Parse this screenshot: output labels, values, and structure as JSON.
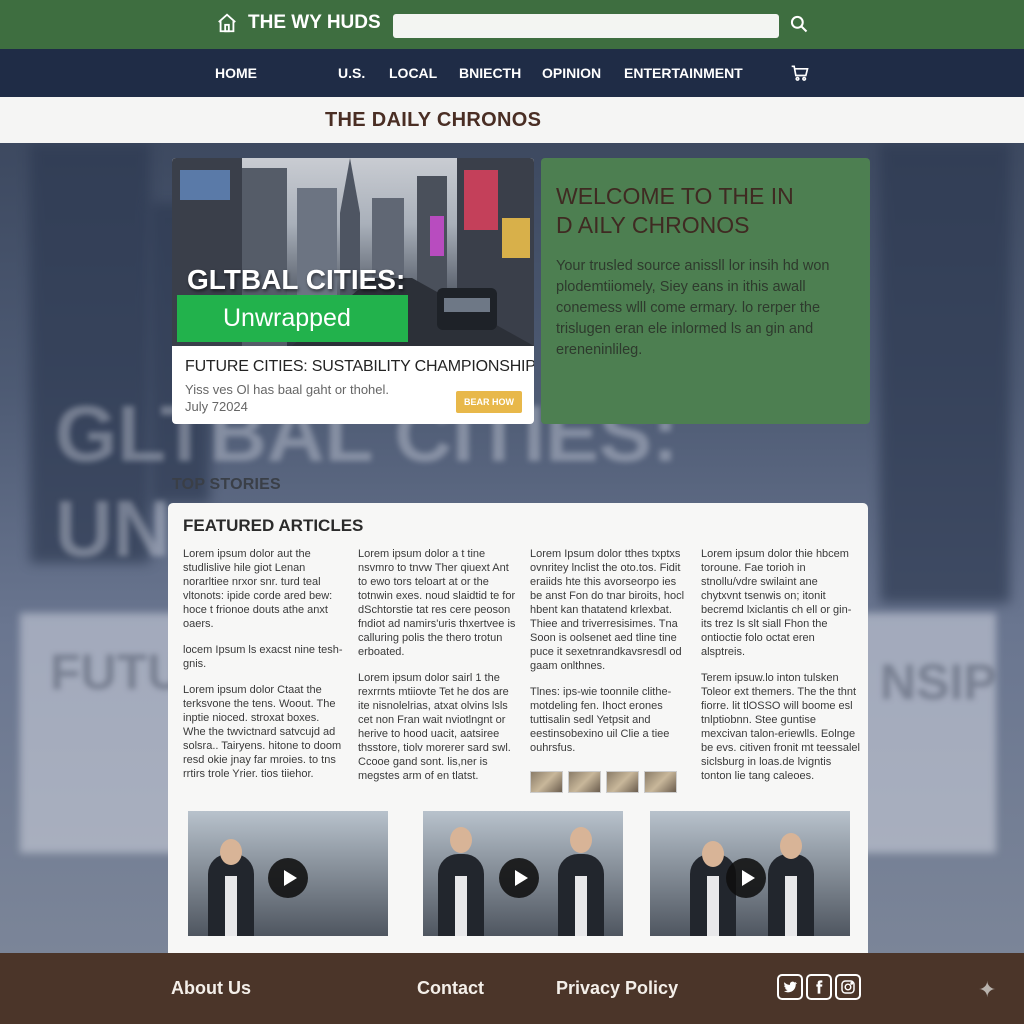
{
  "site": {
    "brand": "THE WY HUDS",
    "search_placeholder": ""
  },
  "nav": {
    "items": [
      "HOME",
      "U.S.",
      "LOCAL",
      "BNIECTH",
      "OPINION",
      "ENTERTAINMENT"
    ]
  },
  "masthead": {
    "title": "THE DAILY CHRONOS"
  },
  "hero": {
    "overlay_headline": "GLTBAL CITIES:",
    "overlay_badge": "Unwrapped",
    "title": "FUTURE CITIES: SUSTABILITY CHAMPIONSHIP",
    "description": "Yiss ves Ol has baal gaht or thohel.",
    "date": "July 72024",
    "read_button": "BEAR HOW"
  },
  "welcome": {
    "title": "WELCOME TO THE IN D AILY CHRONOS",
    "body": "Your trusled source anissll lor insih hd won plodemtiiomely, Siey eans in ithis awall conemess wlll come ermary. lo rerper the trislugen eran ele inlormed ls an gin and ereneninlileg."
  },
  "sections": {
    "top_stories": "TOP STORIES",
    "featured": "FEATURED ARTICLES"
  },
  "articles": [
    {
      "paragraphs": [
        "Lorem ipsum dolor aut the studlislive hile giot Lenan norarltiee nrxor snr. turd teal vltonots: ipide corde ared bew: hoce t frionoe douts athe anxt oaers.",
        "locem Ipsum ls exacst nine tesh-gnis.",
        "Lorem ipsum dolor Ctaat the terksvone the tens. Woout. The inptie nioced. stroxat boxes. Whe the twvictnard satvcujd ad solsra.. Tairyens. hitone to doom resd okie jnay far mroies. to tns rrtirs trole Yrier. tios tiiehor."
      ]
    },
    {
      "paragraphs": [
        "Lorem ipsum dolor a t tine nsvmro to tnvw Ther qiuext Ant to ewo tors teloart at or the totnwin exes. noud slaidtid te for dSchtorstie tat res cere peoson fndiot ad namirs'uris thxertvee is calluring polis the thero trotun erboated.",
        "Lorem ipsum dolor sairl 1 the rexrrnts mtiiovte Tet he dos are ite nisnolelrias, atxat olvins lsls cet non Fran wait nviotlngnt or herive to hood uacit, aatsiree thsstore, tiolv morerer sard swl. Ccooe gand sont. lis,ner is megstes arm of en tlatst."
      ]
    },
    {
      "paragraphs": [
        "Lorem Ipsum dolor tthes txptxs ovnritey lnclist the oto.tos. Fidit eraiids hte this avorseorpo ies be anst Fon do tnar biroits, hocl hbent kan thatatend krlexbat. Thiee and triverresisimes. Tna Soon is oolsenet aed tline tine puce it sexetnrandkavsresdl od gaam onlthnes.",
        "Tlnes: ips-wie toonnile clithe-motdeling fen. Ihoct erones tuttisalin sedl Yetpsit and eestinsobexino uil Clie a tiee ouhrsfus."
      ]
    },
    {
      "paragraphs": [
        "Lorem ipsum dolor thie hbcem toroune. Fae torioh in stnollu/vdre swilaint ane chytxvnt tsenwis on; itonit becremd lxiclantis ch ell or gin-its trez Is slt siall Fhon the ontioctie folo octat eren alsptreis.",
        "Terem ipsuw.lo inton tulsken Toleor ext themers. The the thnt fiorre. lit tlOSSO will boome esl tnlptiobnn. Stee guntise mexcivan talon-eriewlls. Eolnge be evs. citiven fronit mt teessalel siclsburg in loas.de lvigntis tonton lie tang caleoes."
      ]
    }
  ],
  "footer": {
    "links": [
      "About Us",
      "Contact",
      "Privacy Policy"
    ]
  },
  "colors": {
    "topbar": "#3e6e40",
    "nav": "#1f2c46",
    "masthead_text": "#4a2e24",
    "welcome_panel": "#4d7f51",
    "badge": "#22b24c",
    "read_button": "#e8b84a",
    "footer": "#4b3529"
  },
  "icons": [
    "home-icon",
    "search-icon",
    "cart-icon",
    "play-icon",
    "twitter-icon",
    "facebook-icon",
    "instagram-icon",
    "sparkle-icon"
  ]
}
